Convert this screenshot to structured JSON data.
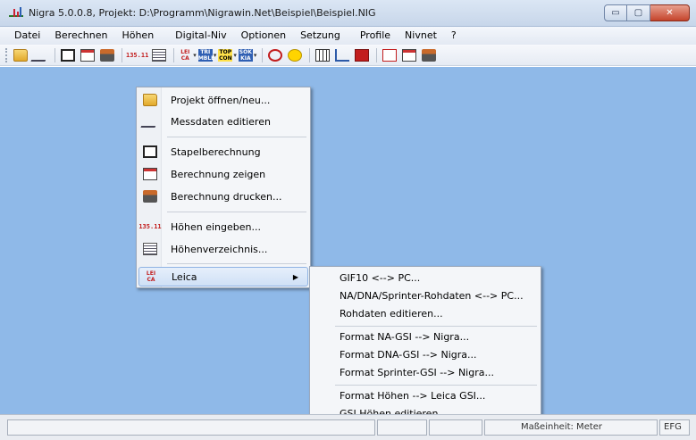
{
  "window": {
    "title": "Nigra 5.0.0.8, Projekt: D:\\Programm\\Nigrawin.Net\\Beispiel\\Beispiel.NIG",
    "min_glyph": "▭",
    "max_glyph": "▢",
    "close_glyph": "✕"
  },
  "menubar": {
    "items": [
      "Datei",
      "Berechnen",
      "Höhen",
      "Digital-Niv",
      "Optionen",
      "Setzung",
      "Profile",
      "Nivnet",
      "?"
    ]
  },
  "toolbar": {
    "txt_hoehen": "135.11",
    "leica_top": "LEI",
    "leica_bottom": "CA",
    "trimble_top": "TRI",
    "trimble_bottom": "MBLE",
    "topcon_top": "TOP",
    "topcon_bottom": "CON",
    "sokkia_top": "SOK",
    "sokkia_bottom": "KIA",
    "dropdown_glyph": "▾"
  },
  "context_menu": {
    "items": [
      {
        "label": "Projekt öffnen/neu...",
        "icon": "folder-icon"
      },
      {
        "label": "Messdaten editieren",
        "icon": "pen-icon"
      },
      {
        "label": "Stapelberechnung",
        "icon": "calculator-icon"
      },
      {
        "label": "Berechnung zeigen",
        "icon": "document-icon"
      },
      {
        "label": "Berechnung drucken...",
        "icon": "printer-icon"
      },
      {
        "label": "Höhen eingeben...",
        "icon": "height-input-icon"
      },
      {
        "label": "Höhenverzeichnis...",
        "icon": "list-icon"
      },
      {
        "label": "Leica",
        "icon": "leica-icon"
      }
    ],
    "hoehen_icon_text": "135.11",
    "leica_icon_top": "LEI",
    "leica_icon_bottom": "CA",
    "submenu_arrow": "▶"
  },
  "submenu": {
    "items": [
      "GIF10 <--> PC...",
      "NA/DNA/Sprinter-Rohdaten <--> PC...",
      "Rohdaten editieren...",
      "Format NA-GSI --> Nigra...",
      "Format DNA-GSI --> Nigra...",
      "Format Sprinter-GSI --> Nigra...",
      "Format Höhen --> Leica GSI...",
      "GSI Höhen editieren"
    ]
  },
  "statusbar": {
    "unit": "Maßeinheit: Meter",
    "mode": "EFG"
  },
  "colors": {
    "workspace": "#8fb9e8",
    "highlight": "#cfe0f6"
  }
}
